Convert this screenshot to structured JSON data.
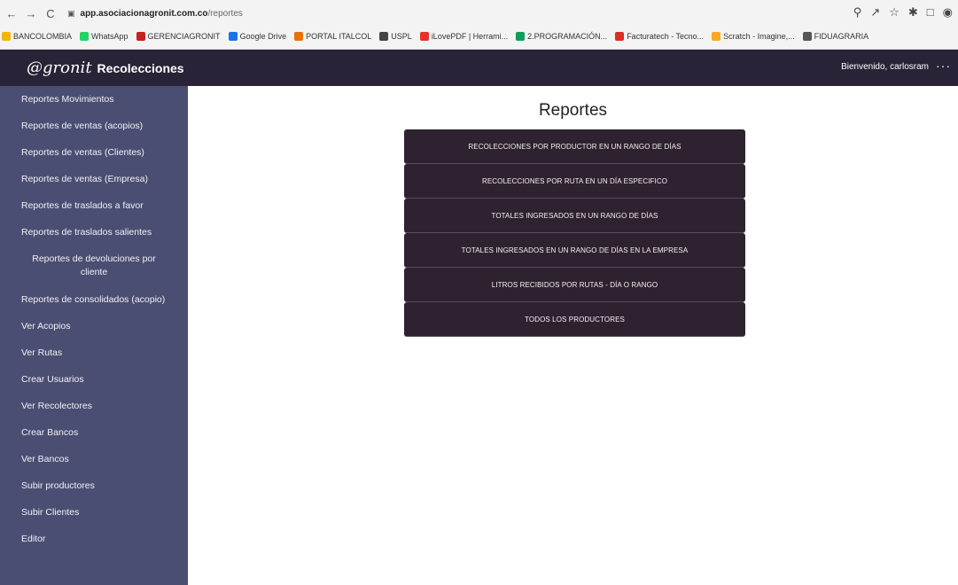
{
  "browser": {
    "url_domain": "app.asociacionagronit.com.co",
    "url_path": "/reportes",
    "nav": {
      "back": "←",
      "forward": "→",
      "reload": "C"
    },
    "right_icons": [
      "search-icon",
      "share-icon",
      "star-icon",
      "pin-icon",
      "tab-icon",
      "avatar-icon"
    ],
    "bookmarks": [
      {
        "label": "BANCOLOMBIA",
        "icon_color": "#f2b705"
      },
      {
        "label": "WhatsApp",
        "icon_color": "#25d366"
      },
      {
        "label": "GERENCIAGRONIT",
        "icon_color": "#c5221f"
      },
      {
        "label": "Google Drive",
        "icon_color": "#1a73e8"
      },
      {
        "label": "PORTAL ITALCOL",
        "icon_color": "#e8710a"
      },
      {
        "label": "USPL",
        "icon_color": "#444444"
      },
      {
        "label": "iLovePDF | Herrami...",
        "icon_color": "#e5322d"
      },
      {
        "label": "2.PROGRAMACIÓN...",
        "icon_color": "#0f9d58"
      },
      {
        "label": "Facturatech - Tecno...",
        "icon_color": "#d93025"
      },
      {
        "label": "Scratch - Imagine,...",
        "icon_color": "#f9a825"
      },
      {
        "label": "FIDUAGRARIA",
        "icon_color": "#555555"
      }
    ]
  },
  "header": {
    "logo_text": "@gronit",
    "brand": "Recolecciones",
    "welcome": "Bienvenido, carlosram",
    "more": "···",
    "colors": {
      "background": "#2a2236"
    }
  },
  "sidebar": {
    "colors": {
      "background": "#4a4e72"
    },
    "items": [
      {
        "label": "Reportes Movimientos"
      },
      {
        "label": "Reportes de ventas (acopios)"
      },
      {
        "label": "Reportes de ventas (Clientes)"
      },
      {
        "label": "Reportes de ventas (Empresa)"
      },
      {
        "label": "Reportes de traslados a favor"
      },
      {
        "label": "Reportes de traslados salientes"
      },
      {
        "label": "Reportes de devoluciones por cliente"
      },
      {
        "label": "Reportes de consolidados (acopio)"
      },
      {
        "label": "Ver Acopios"
      },
      {
        "label": "Ver Rutas"
      },
      {
        "label": "Crear Usuarios"
      },
      {
        "label": "Ver Recolectores"
      },
      {
        "label": "Crear Bancos"
      },
      {
        "label": "Ver Bancos"
      },
      {
        "label": "Subir productores"
      },
      {
        "label": "Subir Clientes"
      },
      {
        "label": "Editor"
      }
    ]
  },
  "main": {
    "title": "Reportes",
    "reports": [
      {
        "label": "RECOLECCIONES POR PRODUCTOR EN UN RANGO DE DÍAS"
      },
      {
        "label": "RECOLECCIONES POR RUTA EN UN DÍA ESPECIFICO"
      },
      {
        "label": "TOTALES INGRESADOS EN UN RANGO DE DÍAS"
      },
      {
        "label": "TOTALES INGRESADOS EN UN RANGO DE DÍAS EN LA EMPRESA"
      },
      {
        "label": "LITROS RECIBIDOS POR RUTAS - DÍA O RANGO"
      },
      {
        "label": "TODOS LOS PRODUCTORES"
      }
    ],
    "colors": {
      "button": "#2f2230"
    }
  }
}
